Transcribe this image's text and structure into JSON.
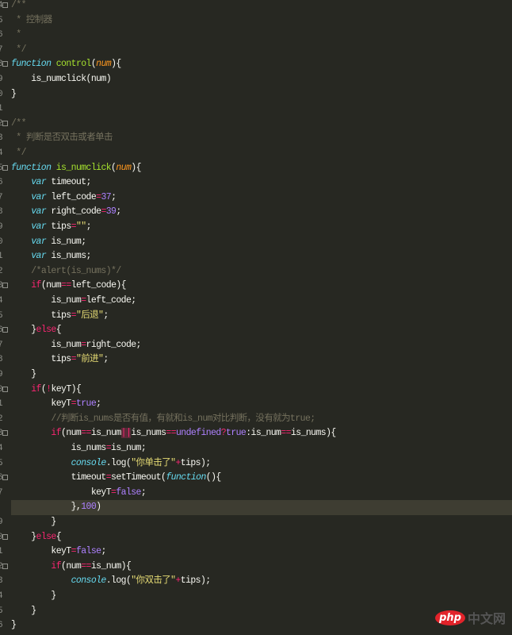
{
  "editor": {
    "colors": {
      "background": "#272822",
      "highlight": "#3e3d32",
      "comment": "#75715e",
      "keyword": "#66d9ef",
      "function": "#a6e22e",
      "param": "#fd971f",
      "operator": "#f92672",
      "string": "#e6db74",
      "number": "#ae81ff"
    },
    "highlighted_line": 34,
    "lines": [
      {
        "ln": "4",
        "fold": true,
        "tokens": [
          [
            "c",
            "/**"
          ]
        ]
      },
      {
        "ln": "5",
        "tokens": [
          [
            "c",
            " * 控制器"
          ]
        ]
      },
      {
        "ln": "6",
        "tokens": [
          [
            "c",
            " *"
          ]
        ]
      },
      {
        "ln": "7",
        "tokens": [
          [
            "c",
            " */"
          ]
        ]
      },
      {
        "ln": "8",
        "fold": true,
        "tokens": [
          [
            "k",
            "function"
          ],
          [
            "t",
            " "
          ],
          [
            "f",
            "control"
          ],
          [
            "t",
            "("
          ],
          [
            "p",
            "num"
          ],
          [
            "t",
            "){"
          ]
        ]
      },
      {
        "ln": "9",
        "tokens": [
          [
            "t",
            "    is_numclick(num)"
          ]
        ]
      },
      {
        "ln": "0",
        "tokens": [
          [
            "t",
            "}"
          ]
        ]
      },
      {
        "ln": "1",
        "tokens": []
      },
      {
        "ln": "2",
        "fold": true,
        "tokens": [
          [
            "c",
            "/**"
          ]
        ]
      },
      {
        "ln": "3",
        "tokens": [
          [
            "c",
            " * 判断是否双击或者单击"
          ]
        ]
      },
      {
        "ln": "4",
        "tokens": [
          [
            "c",
            " */"
          ]
        ]
      },
      {
        "ln": "5",
        "fold": true,
        "tokens": [
          [
            "k",
            "function"
          ],
          [
            "t",
            " "
          ],
          [
            "f",
            "is_numclick"
          ],
          [
            "t",
            "("
          ],
          [
            "p",
            "num"
          ],
          [
            "t",
            "){"
          ]
        ]
      },
      {
        "ln": "6",
        "tokens": [
          [
            "t",
            "    "
          ],
          [
            "k",
            "var"
          ],
          [
            "t",
            " timeout;"
          ]
        ]
      },
      {
        "ln": "7",
        "tokens": [
          [
            "t",
            "    "
          ],
          [
            "k",
            "var"
          ],
          [
            "t",
            " left_code"
          ],
          [
            "o",
            "="
          ],
          [
            "n",
            "37"
          ],
          [
            "t",
            ";"
          ]
        ]
      },
      {
        "ln": "8",
        "tokens": [
          [
            "t",
            "    "
          ],
          [
            "k",
            "var"
          ],
          [
            "t",
            " right_code"
          ],
          [
            "o",
            "="
          ],
          [
            "n",
            "39"
          ],
          [
            "t",
            ";"
          ]
        ]
      },
      {
        "ln": "9",
        "tokens": [
          [
            "t",
            "    "
          ],
          [
            "k",
            "var"
          ],
          [
            "t",
            " tips"
          ],
          [
            "o",
            "="
          ],
          [
            "s",
            "\"\""
          ],
          [
            "t",
            ";"
          ]
        ]
      },
      {
        "ln": "0",
        "tokens": [
          [
            "t",
            "    "
          ],
          [
            "k",
            "var"
          ],
          [
            "t",
            " is_num;"
          ]
        ]
      },
      {
        "ln": "1",
        "tokens": [
          [
            "t",
            "    "
          ],
          [
            "k",
            "var"
          ],
          [
            "t",
            " is_nums;"
          ]
        ]
      },
      {
        "ln": "2",
        "tokens": [
          [
            "t",
            "    "
          ],
          [
            "c",
            "/*alert(is_nums)*/"
          ]
        ]
      },
      {
        "ln": "3",
        "fold": true,
        "tokens": [
          [
            "t",
            "    "
          ],
          [
            "o",
            "if"
          ],
          [
            "t",
            "(num"
          ],
          [
            "o",
            "=="
          ],
          [
            "t",
            "left_code){"
          ]
        ]
      },
      {
        "ln": "4",
        "tokens": [
          [
            "t",
            "        is_num"
          ],
          [
            "o",
            "="
          ],
          [
            "t",
            "left_code;"
          ]
        ]
      },
      {
        "ln": "5",
        "tokens": [
          [
            "t",
            "        tips"
          ],
          [
            "o",
            "="
          ],
          [
            "s",
            "\"后退\""
          ],
          [
            "t",
            ";"
          ]
        ]
      },
      {
        "ln": "6",
        "fold": true,
        "tokens": [
          [
            "t",
            "    }"
          ],
          [
            "o",
            "else"
          ],
          [
            "t",
            "{"
          ]
        ]
      },
      {
        "ln": "7",
        "tokens": [
          [
            "t",
            "        is_num"
          ],
          [
            "o",
            "="
          ],
          [
            "t",
            "right_code;"
          ]
        ]
      },
      {
        "ln": "8",
        "tokens": [
          [
            "t",
            "        tips"
          ],
          [
            "o",
            "="
          ],
          [
            "s",
            "\"前进\""
          ],
          [
            "t",
            ";"
          ]
        ]
      },
      {
        "ln": "9",
        "tokens": [
          [
            "t",
            "    }"
          ]
        ]
      },
      {
        "ln": "0",
        "fold": true,
        "tokens": [
          [
            "t",
            "    "
          ],
          [
            "o",
            "if"
          ],
          [
            "t",
            "("
          ],
          [
            "o",
            "!"
          ],
          [
            "t",
            "keyT){"
          ]
        ]
      },
      {
        "ln": "1",
        "tokens": [
          [
            "t",
            "        keyT"
          ],
          [
            "o",
            "="
          ],
          [
            "n",
            "true"
          ],
          [
            "t",
            ";"
          ]
        ]
      },
      {
        "ln": "2",
        "tokens": [
          [
            "t",
            "        "
          ],
          [
            "c",
            "//判断is_nums是否有值，有就和is_num对比判断，没有就为true;"
          ]
        ]
      },
      {
        "ln": "3",
        "fold": true,
        "tokens": [
          [
            "t",
            "        "
          ],
          [
            "o",
            "if"
          ],
          [
            "t",
            "(num"
          ],
          [
            "o",
            "=="
          ],
          [
            "t",
            "is_num"
          ],
          [
            "x",
            "||"
          ],
          [
            "t",
            "is_nums"
          ],
          [
            "o",
            "=="
          ],
          [
            "n",
            "undefined"
          ],
          [
            "o",
            "?"
          ],
          [
            "n",
            "true"
          ],
          [
            "t",
            ":is_num"
          ],
          [
            "o",
            "=="
          ],
          [
            "t",
            "is_nums){"
          ]
        ]
      },
      {
        "ln": "4",
        "tokens": [
          [
            "t",
            "            is_nums"
          ],
          [
            "o",
            "="
          ],
          [
            "t",
            "is_num;"
          ]
        ]
      },
      {
        "ln": "5",
        "tokens": [
          [
            "t",
            "            "
          ],
          [
            "k",
            "console"
          ],
          [
            "t",
            ".log("
          ],
          [
            "s",
            "\"你单击了\""
          ],
          [
            "o",
            "+"
          ],
          [
            "t",
            "tips);"
          ]
        ]
      },
      {
        "ln": "6",
        "fold": true,
        "tokens": [
          [
            "t",
            "            timeout"
          ],
          [
            "o",
            "="
          ],
          [
            "t",
            "setTimeout("
          ],
          [
            "k",
            "function"
          ],
          [
            "t",
            "(){"
          ]
        ]
      },
      {
        "ln": "7",
        "tokens": [
          [
            "t",
            "                keyT"
          ],
          [
            "o",
            "="
          ],
          [
            "n",
            "false"
          ],
          [
            "t",
            ";"
          ]
        ]
      },
      {
        "ln": "8",
        "tokens": [
          [
            "t",
            "            },"
          ],
          [
            "n",
            "100"
          ],
          [
            "t",
            ")"
          ]
        ]
      },
      {
        "ln": "9",
        "tokens": [
          [
            "t",
            "        }"
          ]
        ]
      },
      {
        "ln": "0",
        "fold": true,
        "tokens": [
          [
            "t",
            "    }"
          ],
          [
            "o",
            "else"
          ],
          [
            "t",
            "{"
          ]
        ]
      },
      {
        "ln": "1",
        "tokens": [
          [
            "t",
            "        keyT"
          ],
          [
            "o",
            "="
          ],
          [
            "n",
            "false"
          ],
          [
            "t",
            ";"
          ]
        ]
      },
      {
        "ln": "2",
        "fold": true,
        "tokens": [
          [
            "t",
            "        "
          ],
          [
            "o",
            "if"
          ],
          [
            "t",
            "(num"
          ],
          [
            "o",
            "=="
          ],
          [
            "t",
            "is_num){"
          ]
        ]
      },
      {
        "ln": "3",
        "tokens": [
          [
            "t",
            "            "
          ],
          [
            "k",
            "console"
          ],
          [
            "t",
            ".log("
          ],
          [
            "s",
            "\"你双击了\""
          ],
          [
            "o",
            "+"
          ],
          [
            "t",
            "tips);"
          ]
        ]
      },
      {
        "ln": "4",
        "tokens": [
          [
            "t",
            "        }"
          ]
        ]
      },
      {
        "ln": "5",
        "tokens": [
          [
            "t",
            "    }"
          ]
        ]
      },
      {
        "ln": "6",
        "tokens": [
          [
            "t",
            "}"
          ]
        ]
      }
    ]
  },
  "watermark": {
    "logo": "php",
    "text": "中文网"
  }
}
